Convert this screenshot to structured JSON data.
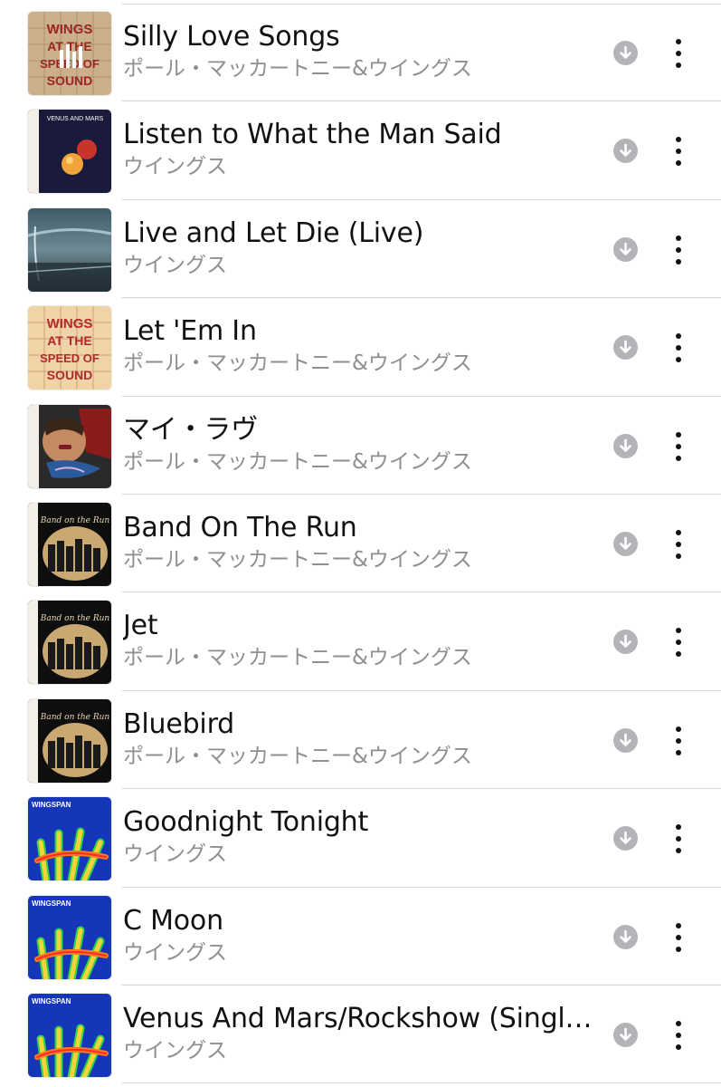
{
  "songs": [
    {
      "title": "Silly Love Songs",
      "artist": "ポール・マッカートニー&ウイングス",
      "artwork": "wings-speed-of-sound-playing"
    },
    {
      "title": "Listen to What the Man Said",
      "artist": "ウイングス",
      "artwork": "venus-and-mars"
    },
    {
      "title": "Live and Let Die (Live)",
      "artist": "ウイングス",
      "artwork": "wings-over-america"
    },
    {
      "title": "Let 'Em In",
      "artist": "ポール・マッカートニー&ウイングス",
      "artwork": "wings-speed-of-sound"
    },
    {
      "title": "マイ・ラヴ",
      "artist": "ポール・マッカートニー&ウイングス",
      "artwork": "red-rose-speedway"
    },
    {
      "title": "Band On The Run",
      "artist": "ポール・マッカートニー&ウイングス",
      "artwork": "band-on-the-run"
    },
    {
      "title": "Jet",
      "artist": "ポール・マッカートニー&ウイングス",
      "artwork": "band-on-the-run"
    },
    {
      "title": "Bluebird",
      "artist": "ポール・マッカートニー&ウイングス",
      "artwork": "band-on-the-run"
    },
    {
      "title": "Goodnight Tonight",
      "artist": "ウイングス",
      "artwork": "wingspan"
    },
    {
      "title": "C Moon",
      "artist": "ウイングス",
      "artwork": "wingspan"
    },
    {
      "title": "Venus And Mars/Rockshow (Singl…",
      "artist": "ウイングス",
      "artwork": "wingspan"
    }
  ],
  "artwork_text": {
    "speed_line1": "WINGS",
    "speed_line2": "AT THE",
    "speed_line3": "SPEED OF",
    "speed_line4": "SOUND",
    "venus": "VENUS AND MARS",
    "band": "Band on the Run",
    "wingspan": "WINGSPAN"
  },
  "icons": {
    "download": "download-circle-icon",
    "more": "vertical-ellipsis-icon",
    "now_playing": "now-playing-bars-icon"
  },
  "colors": {
    "title": "#111111",
    "subtitle": "#8e8e93",
    "download_icon": "#b4b4b8",
    "separator": "#d4d4d6"
  }
}
